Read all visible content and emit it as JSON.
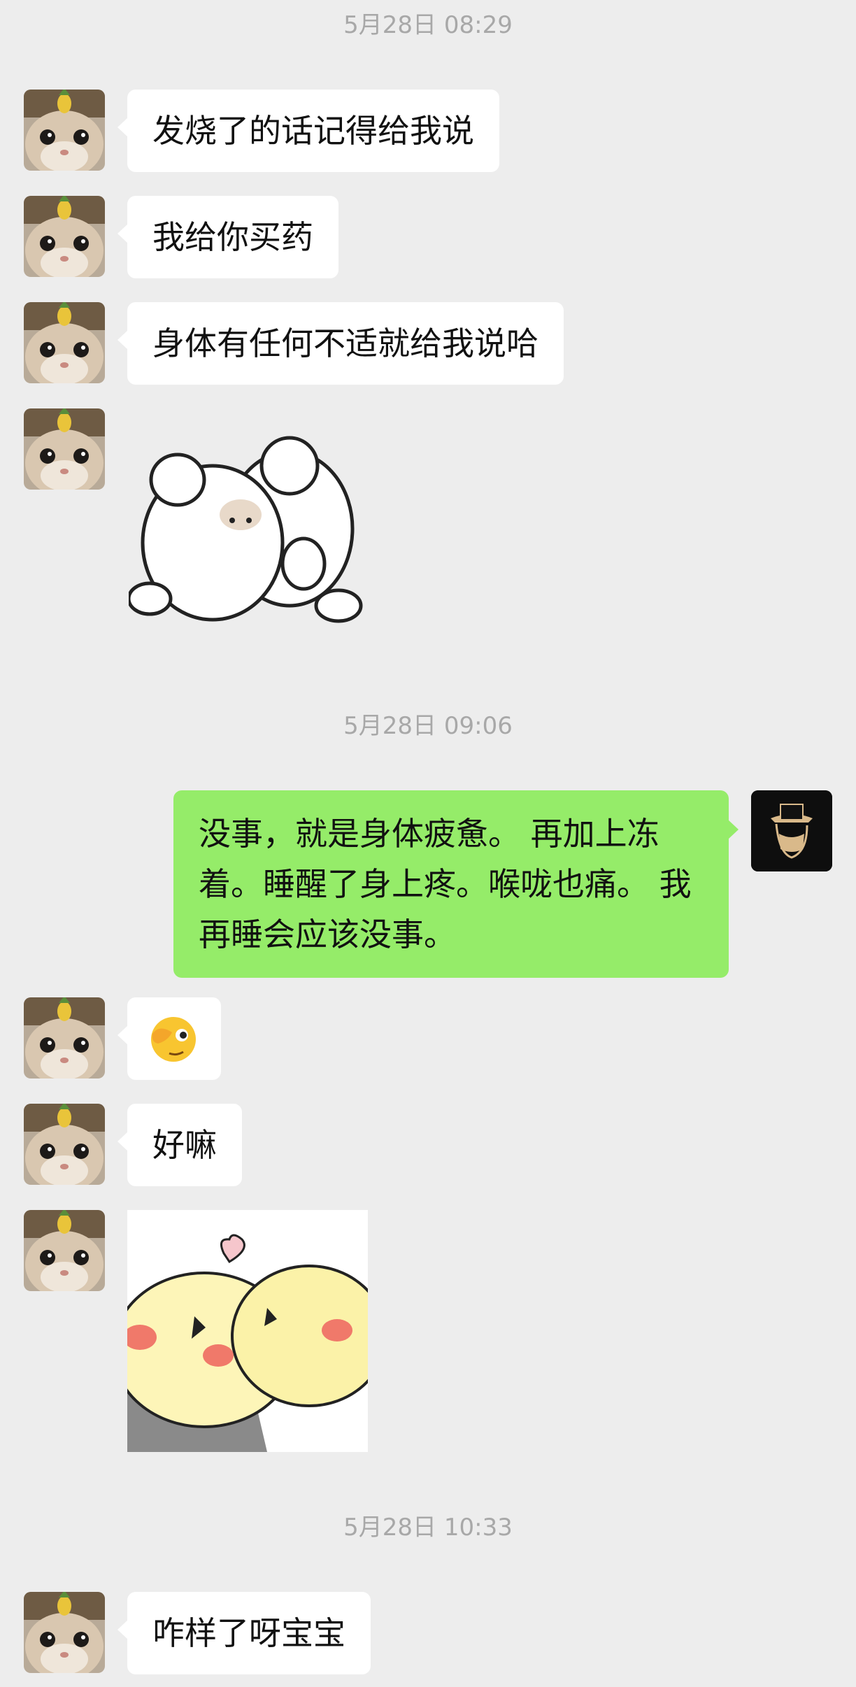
{
  "timestamps": [
    "5月28日 08:29",
    "5月28日 09:06",
    "5月28日 10:33"
  ],
  "messages": {
    "m1": "发烧了的话记得给我说",
    "m2": "我给你买药",
    "m3": "身体有任何不适就给我说哈",
    "m4": "没事，就是身体疲惫。 再加上冻着。睡醒了身上疼。喉咙也痛。 我再睡会应该没事。",
    "m5": "好嘛",
    "m6": "咋样了呀宝宝"
  },
  "icons": {
    "emoji": "face-with-hand-over-eye-emoji",
    "sticker1": "bunny-hug-sticker",
    "sticker2": "yellow-birds-heart-sticker"
  },
  "colors": {
    "background": "#ededed",
    "incoming_bubble": "#ffffff",
    "outgoing_bubble": "#95ec69",
    "timestamp_text": "#a8a8a8"
  }
}
